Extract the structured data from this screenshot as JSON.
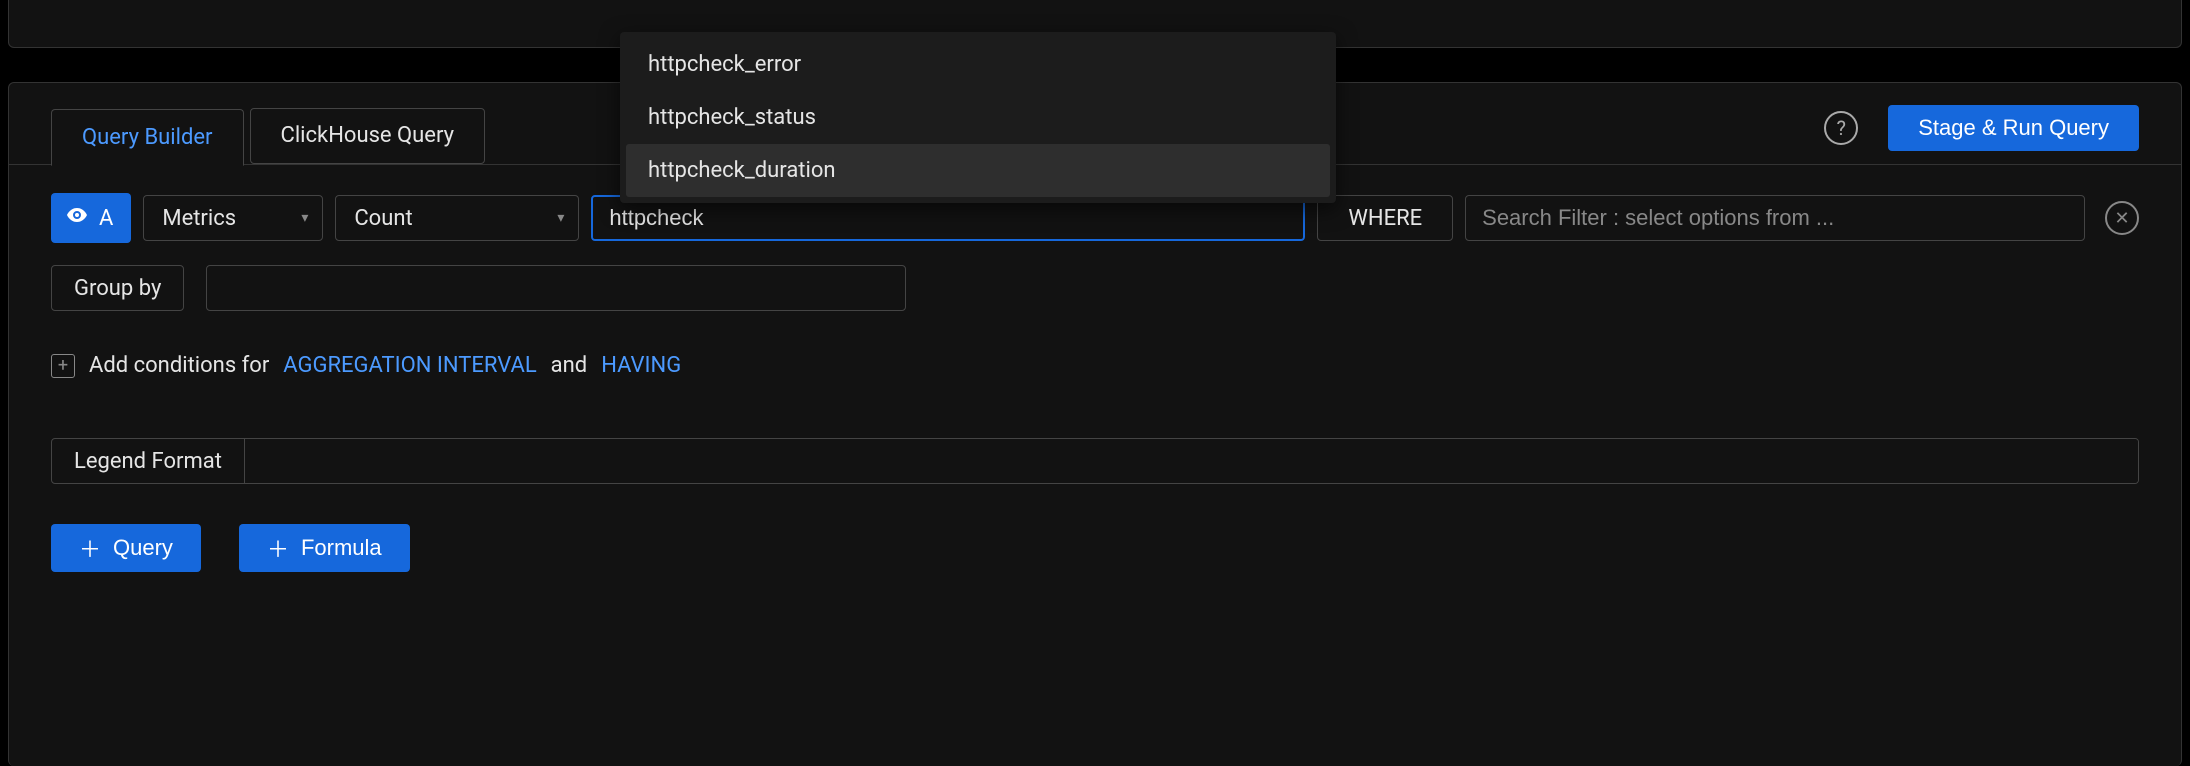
{
  "tabs": {
    "query_builder": "Query Builder",
    "clickhouse": "ClickHouse Query"
  },
  "header": {
    "run_button": "Stage & Run Query"
  },
  "row1": {
    "chip": "A",
    "metrics_select": "Metrics",
    "count_select": "Count",
    "metric_input_value": "httpcheck",
    "where_label": "WHERE",
    "filter_placeholder": "Search Filter : select options from ..."
  },
  "dropdown": {
    "items": [
      {
        "label": "httpcheck_error"
      },
      {
        "label": "httpcheck_status"
      },
      {
        "label": "httpcheck_duration"
      }
    ]
  },
  "groupby": {
    "label": "Group by"
  },
  "conditions": {
    "prefix": "Add conditions for",
    "agg": "AGGREGATION INTERVAL",
    "and": "and",
    "having": "HAVING"
  },
  "legend": {
    "label": "Legend Format"
  },
  "buttons": {
    "query": "Query",
    "formula": "Formula"
  }
}
